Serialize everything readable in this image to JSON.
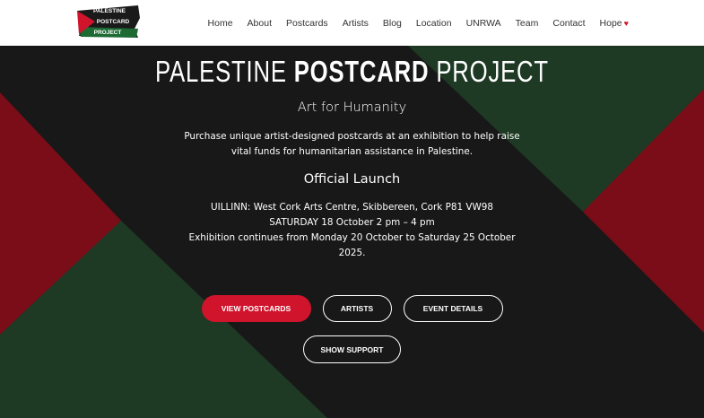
{
  "logo": {
    "line1": "PALESTINE",
    "line2": "POSTCARD",
    "line3": "PROJECT"
  },
  "nav": {
    "items": [
      "Home",
      "About",
      "Postcards",
      "Artists",
      "Blog",
      "Location",
      "UNRWA",
      "Team",
      "Contact",
      "Hope"
    ],
    "heart": "♥"
  },
  "hero": {
    "title_light": "PALESTINE",
    "title_bold": "POSTCARD",
    "title_light2": "PROJECT",
    "subtitle": "Art for Humanity",
    "description": "Purchase unique artist-designed postcards at an exhibition to help raise vital funds for humanitarian assistance in Palestine.",
    "launch_heading": "Official Launch",
    "venue": "UILLINN: West Cork Arts Centre, Skibbereen, Cork P81 VW98",
    "date": "SATURDAY 18 October 2 pm – 4 pm",
    "continues": "Exhibition continues from Monday 20 October to Saturday 25 October 2025."
  },
  "buttons": {
    "view_postcards": "VIEW POSTCARDS",
    "artists": "ARTISTS",
    "event_details": "EVENT DETAILS",
    "show_support": "SHOW SUPPORT"
  },
  "colors": {
    "red": "#d0142c",
    "dark": "#181818",
    "green": "#1e3a24",
    "maroon": "#7a0d17"
  }
}
